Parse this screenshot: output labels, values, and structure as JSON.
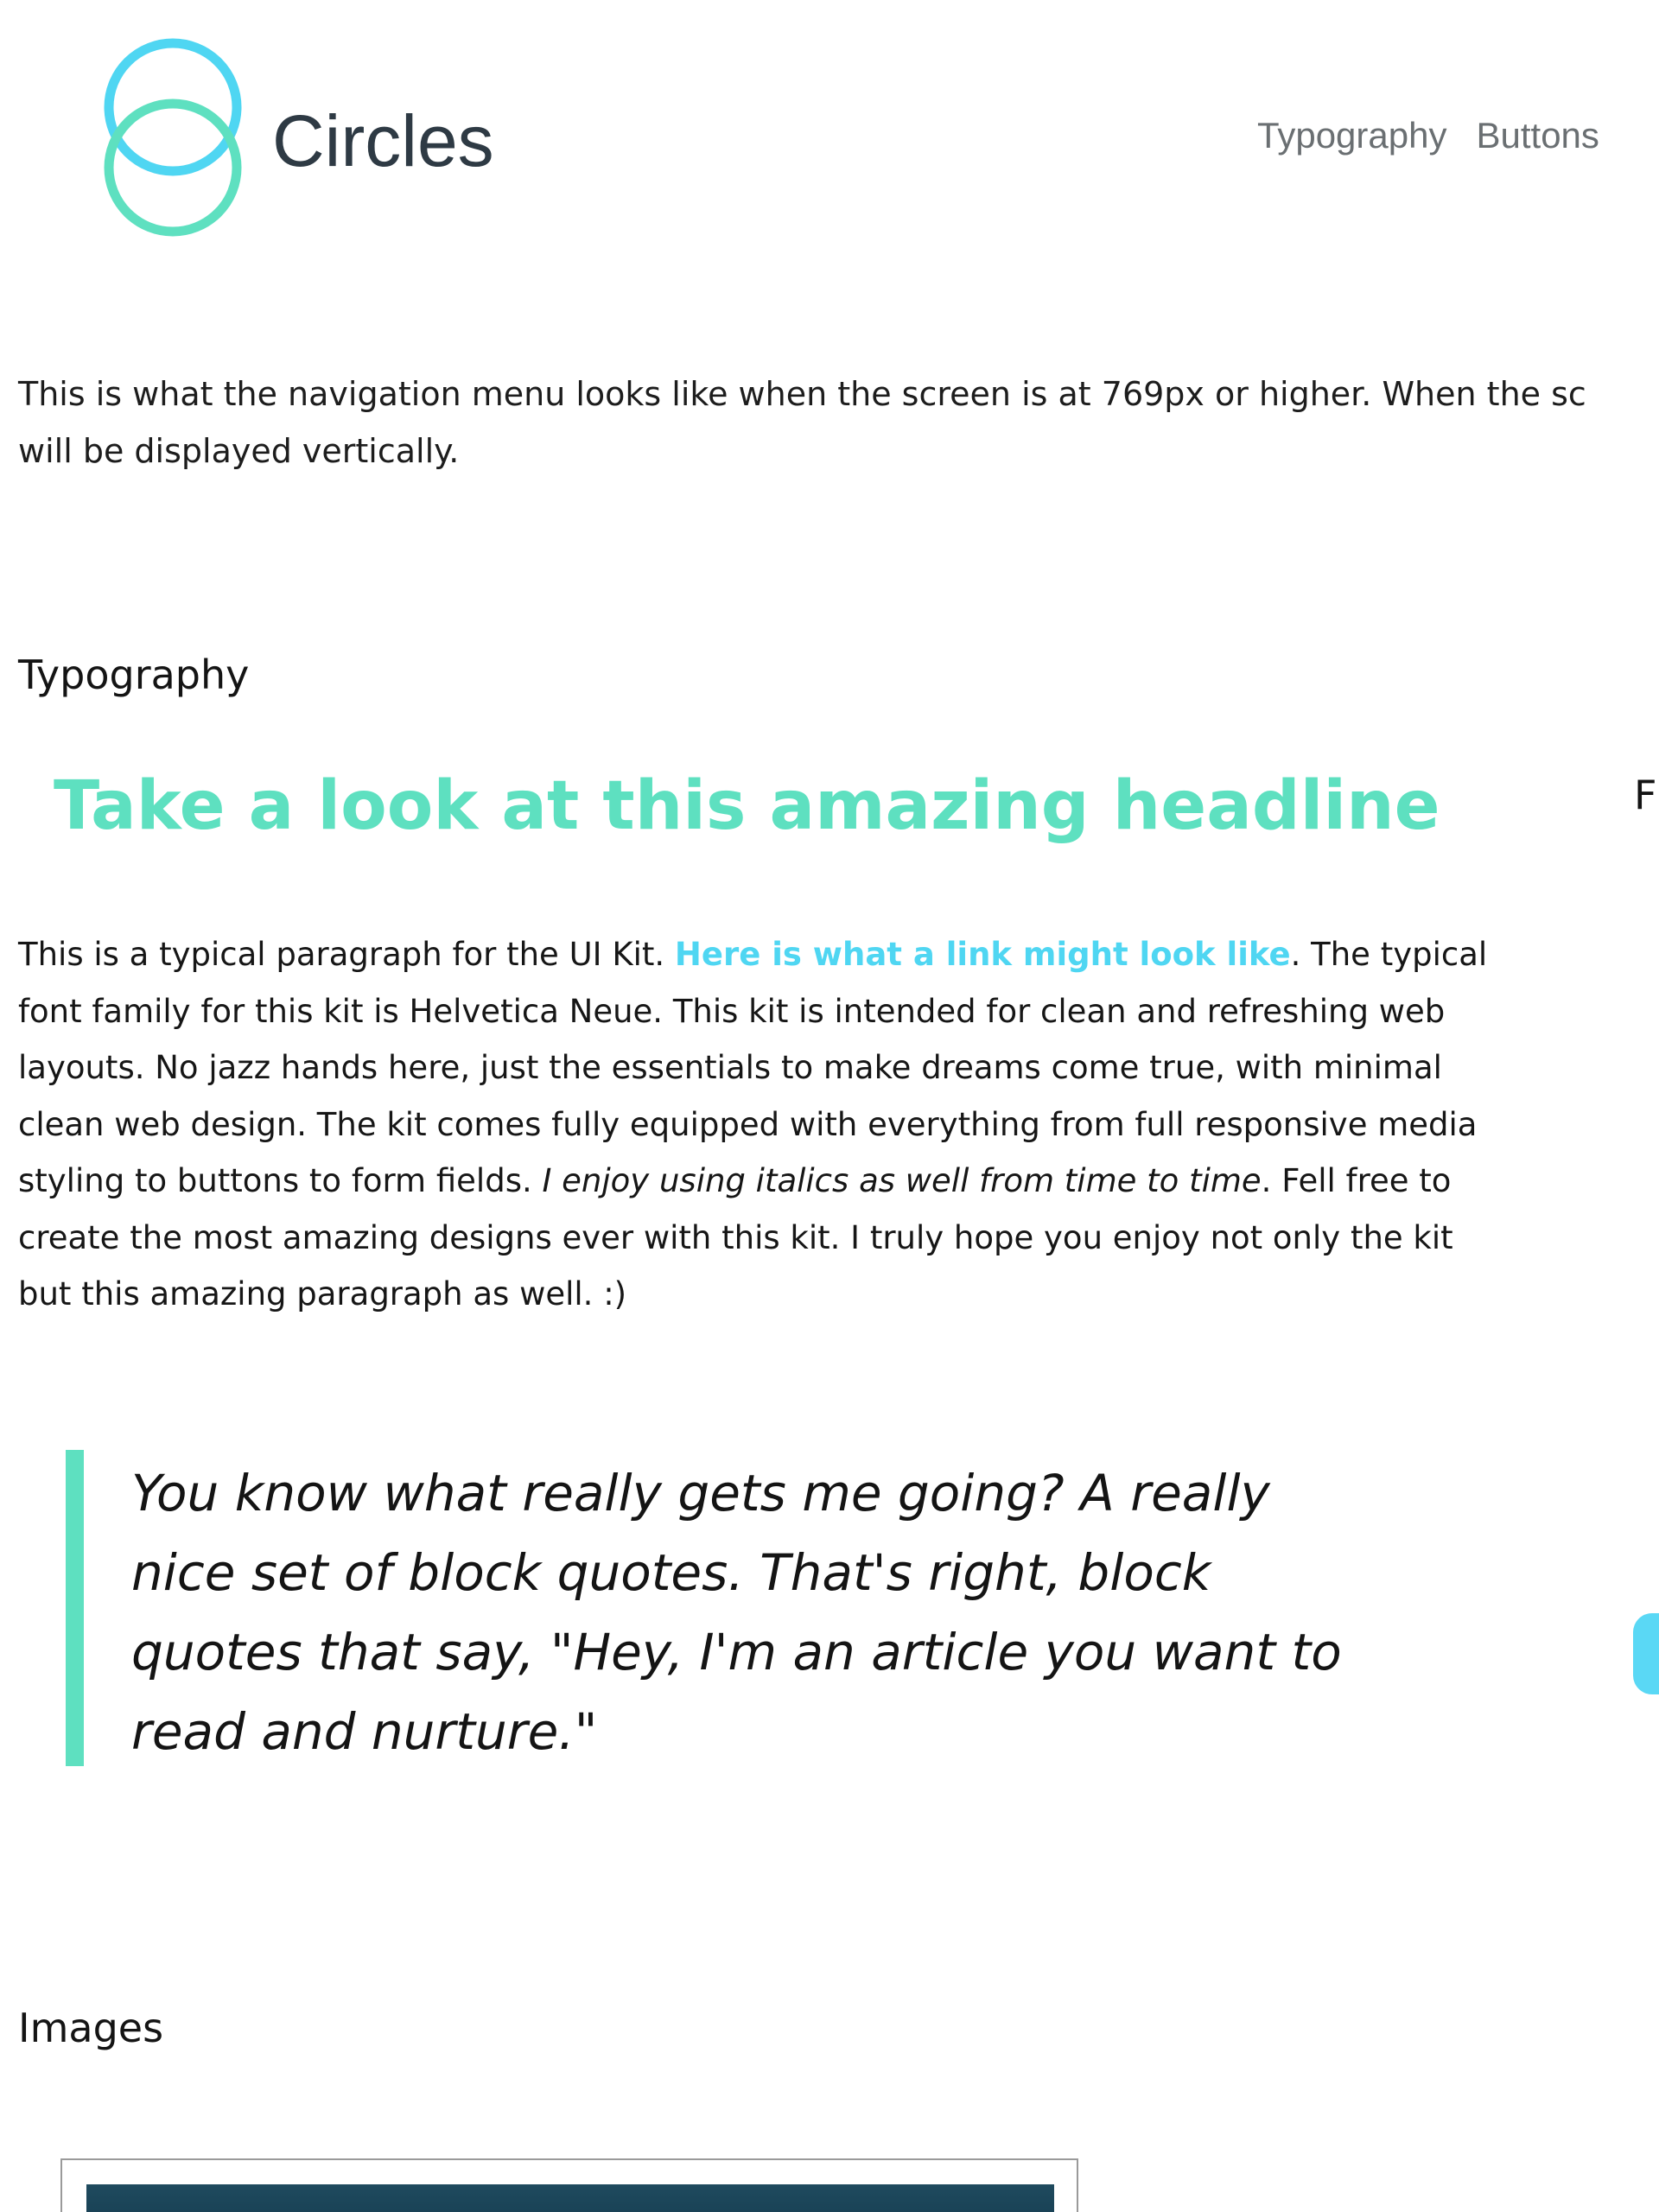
{
  "brand": {
    "name": "Circles",
    "colors": {
      "ring_top": "#4fd6f2",
      "ring_bottom": "#5ee0c0",
      "wordmark": "#2e3a44"
    }
  },
  "nav": {
    "items": [
      {
        "label": "Typography"
      },
      {
        "label": "Buttons"
      }
    ]
  },
  "intro": {
    "line1": "This is what the navigation menu looks like when the screen is at 769px or higher. When the sc",
    "line2": "will be displayed vertically."
  },
  "typography_section": {
    "heading": "Typography",
    "headline": "Take a look at this amazing headline",
    "right_edge_heading_fragment": "F",
    "paragraph": {
      "text_start": "This is a typical paragraph for the UI Kit. ",
      "link_text": "Here is what a link might look like",
      "text_middle": ". The typical font family for this kit is Helvetica Neue. This kit is intended for clean and refreshing web layouts. No jazz hands here, just the essentials to make dreams come true, with minimal clean web design. The kit comes fully equipped with everything from full responsive media styling to buttons to form fields. ",
      "italic_text": "I enjoy using italics as well from time to time",
      "text_end": ". Fell free to create the most amazing designs ever with this kit. I truly hope you enjoy not only the kit but this amazing paragraph as well. :)"
    },
    "blockquote": {
      "lines": [
        "You know what really gets me going? A really",
        "nice set of block quotes. That's right, block",
        "quotes that say, \"Hey, I'm an article you want to",
        "read and nurture.\""
      ]
    }
  },
  "images_section": {
    "heading": "Images"
  },
  "colors": {
    "accent_green": "#5ee0c0",
    "accent_blue": "#4fd6f2",
    "text": "#141414",
    "nav_text": "#6a6f72"
  }
}
